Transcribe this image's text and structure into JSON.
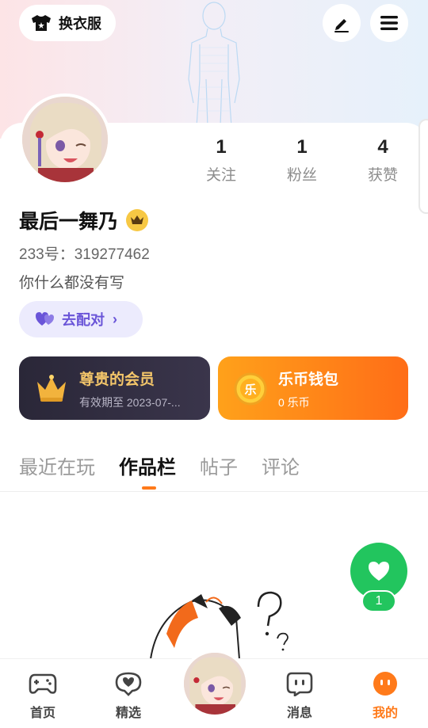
{
  "header": {
    "outfit_label": "换衣服"
  },
  "profile": {
    "stats": [
      {
        "value": "1",
        "label": "关注"
      },
      {
        "value": "1",
        "label": "粉丝"
      },
      {
        "value": "4",
        "label": "获赞"
      }
    ],
    "username": "最后一舞乃",
    "user_id": "233号：319277462",
    "bio": "你什么都没有写",
    "match_label": "去配对"
  },
  "cards": {
    "vip": {
      "title": "尊贵的会员",
      "subtitle": "有效期至 2023-07-..."
    },
    "wallet": {
      "title": "乐币钱包",
      "subtitle": "0 乐币",
      "coin_char": "乐"
    }
  },
  "tabs": [
    {
      "label": "最近在玩",
      "active": false
    },
    {
      "label": "作品栏",
      "active": true
    },
    {
      "label": "帖子",
      "active": false
    },
    {
      "label": "评论",
      "active": false
    }
  ],
  "like": {
    "count": "1"
  },
  "nav": [
    {
      "label": "首页",
      "icon": "gamepad-icon"
    },
    {
      "label": "精选",
      "icon": "heart-chat-icon"
    },
    {
      "label": "消息",
      "icon": "message-icon"
    },
    {
      "label": "我的",
      "icon": "face-icon",
      "active": true
    }
  ],
  "colors": {
    "accent": "#ff7a1a",
    "vip_gold": "#f4c66a",
    "match_purple": "#6a55d8",
    "like_green": "#22c55e"
  }
}
